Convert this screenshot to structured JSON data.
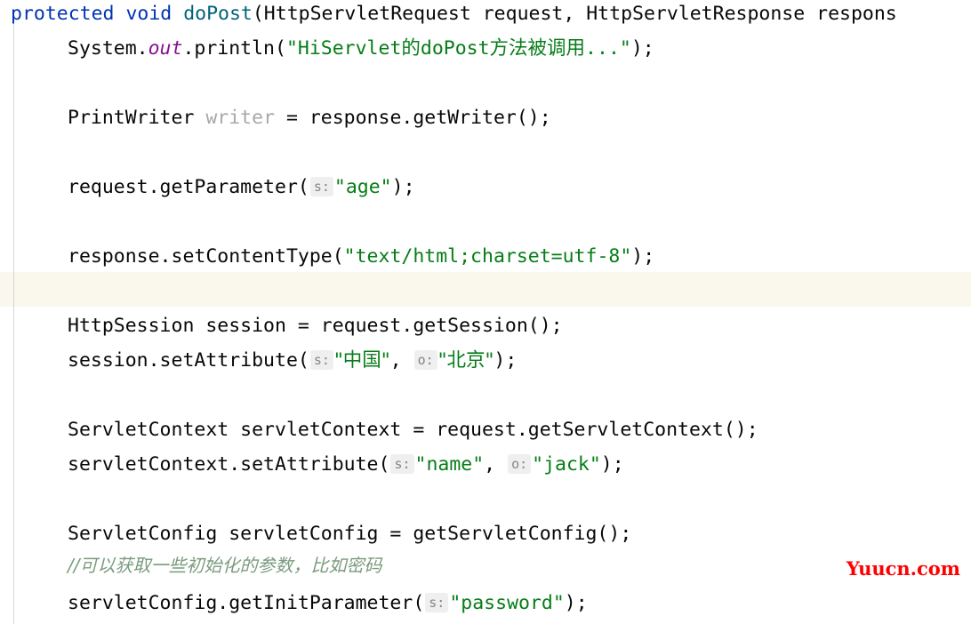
{
  "editor": {
    "language": "java",
    "background_color": "#ffffff",
    "caret_line_color": "#faf8ec",
    "indent_guide_color": "#d4d4d4",
    "colors": {
      "keyword": "#0033b3",
      "method_declaration": "#00627a",
      "string": "#067d17",
      "static_field": "#871094",
      "unused_identifier": "#a8a8a8",
      "comment_cjk": "#7a9b7e",
      "default_text": "#080808",
      "inline_hint_bg": "#efefef",
      "inline_hint_fg": "#868686",
      "watermark": "#ff0000"
    }
  },
  "code": {
    "line1": {
      "kw_protected": "protected",
      "sp1": " ",
      "kw_void": "void",
      "sp2": " ",
      "method": "doPost",
      "rest": "(HttpServletRequest request, HttpServletResponse respons"
    },
    "line2": {
      "a": "System.",
      "field": "out",
      "b": ".println(",
      "str": "\"HiServlet的doPost方法被调用...\"",
      "c": ");"
    },
    "line4": {
      "a": "PrintWriter ",
      "unused": "writer",
      "b": " = response.getWriter();"
    },
    "line6": {
      "a": "request.getParameter(",
      "hint": "s:",
      "str": "\"age\"",
      "b": ");"
    },
    "line8": {
      "a": "response.setContentType(",
      "str": "\"text/html;charset=utf-8\"",
      "b": ");"
    },
    "line10": {
      "a": "HttpSession session = request.getSession();"
    },
    "line11": {
      "a": "session.setAttribute(",
      "hint1": "s:",
      "str1": "\"中国\"",
      "b": ", ",
      "hint2": "o:",
      "str2": "\"北京\"",
      "c": ");"
    },
    "line13": {
      "a": "ServletContext servletContext = request.getServletContext();"
    },
    "line14": {
      "a": "servletContext.setAttribute(",
      "hint1": "s:",
      "str1": "\"name\"",
      "b": ", ",
      "hint2": "o:",
      "str2": "\"jack\"",
      "c": ");"
    },
    "line16": {
      "a": "ServletConfig servletConfig = getServletConfig();"
    },
    "line17": {
      "comment": "//可以获取一些初始化的参数，比如密码"
    },
    "line18": {
      "a": "servletConfig.getInitParameter(",
      "hint": "s:",
      "str": "\"password\"",
      "b": ");"
    }
  },
  "watermark": {
    "text": "Yuucn.com"
  }
}
